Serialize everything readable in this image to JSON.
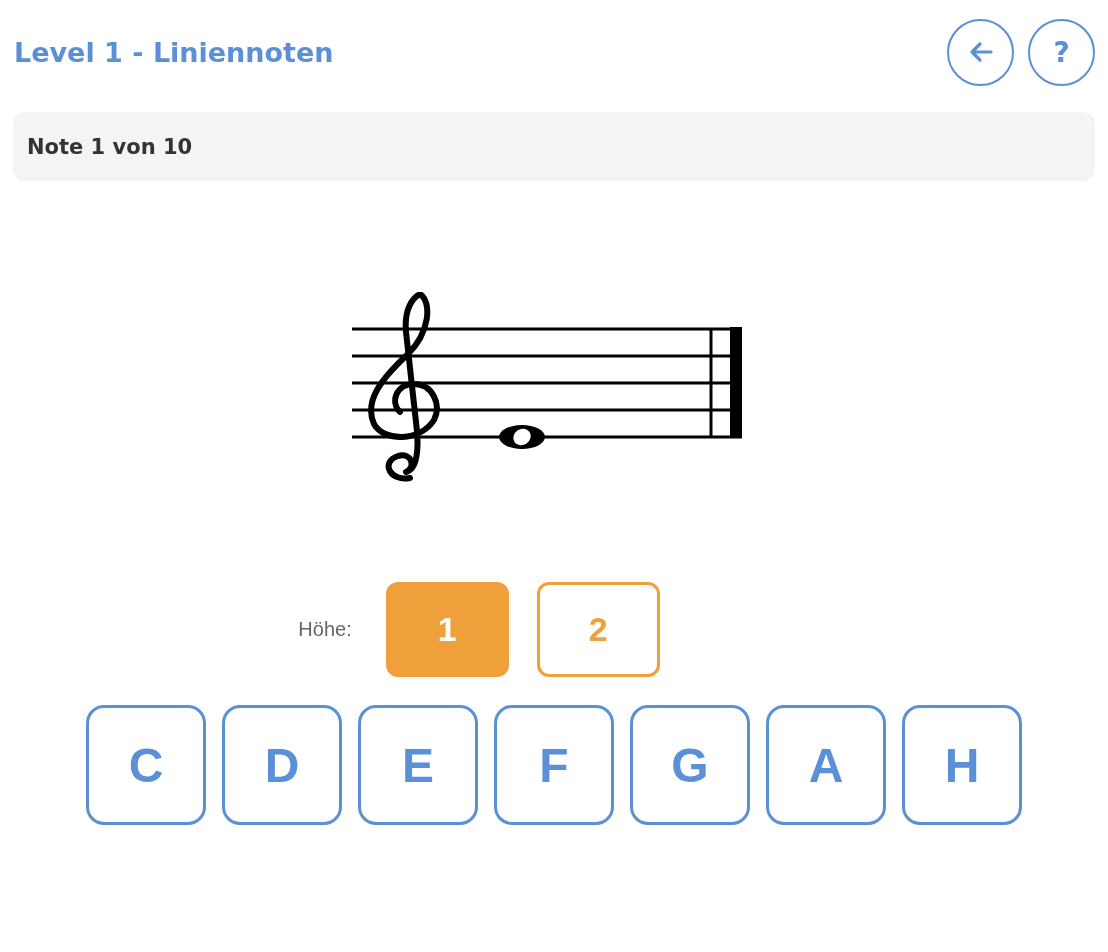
{
  "header": {
    "title": "Level 1 - Liniennoten",
    "buttons": [
      {
        "kind": "back"
      },
      {
        "kind": "help",
        "label": "?"
      }
    ]
  },
  "progress": "Note 1 von 10",
  "height": {
    "label": "Höhe:",
    "options": [
      {
        "label": "1",
        "selected": true
      },
      {
        "label": "2",
        "selected": false
      }
    ]
  },
  "note_buttons": [
    "C",
    "D",
    "E",
    "F",
    "G",
    "A",
    "H"
  ]
}
